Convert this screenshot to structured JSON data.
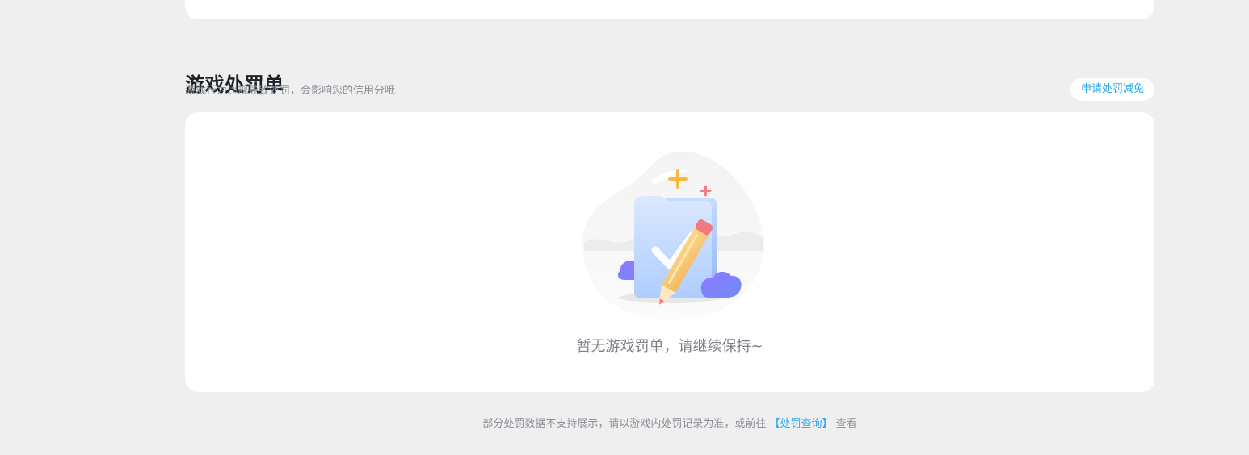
{
  "section": {
    "title": "游戏处罚单",
    "subtitle": "游戏行为违规导致处罚，会影响您的信用分哦",
    "apply_button_label": "申请处罚减免"
  },
  "empty_state": {
    "illustration_icon": "empty-clipboard-pencil-icon",
    "message": "暂无游戏罚单，请继续保持~"
  },
  "footer": {
    "note_prefix": "部分处罚数据不支持展示，请以游戏内处罚记录为准，或前往",
    "link_label": "【处罚查询】",
    "note_suffix": "查看"
  },
  "colors": {
    "page_background": "#efefef",
    "card_background": "#ffffff",
    "accent": "#29a9e8",
    "title_text": "#1d2129",
    "muted_text": "#8a8f99"
  }
}
